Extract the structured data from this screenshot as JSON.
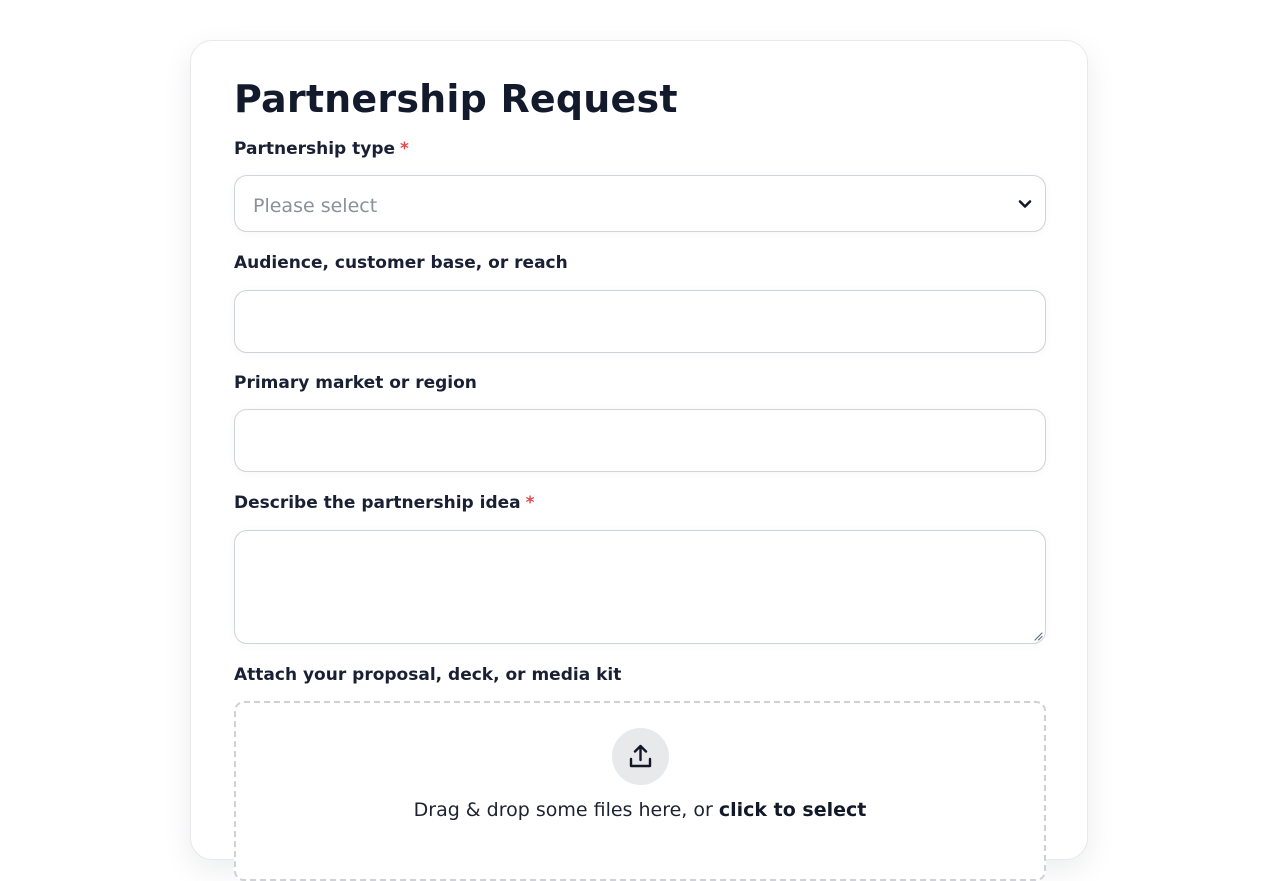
{
  "form": {
    "title": "Partnership Request",
    "required_marker": "*",
    "fields": [
      {
        "label": "Partnership type",
        "required": true,
        "type": "select",
        "value": "Please select"
      },
      {
        "label": "Audience, customer base, or reach",
        "required": false,
        "type": "text",
        "value": ""
      },
      {
        "label": "Primary market or region",
        "required": false,
        "type": "text",
        "value": ""
      },
      {
        "label": "Describe the partnership idea",
        "required": true,
        "type": "textarea",
        "value": ""
      }
    ],
    "attachment": {
      "label": "Attach your proposal, deck, or media kit",
      "drop_text": "Drag & drop some files here, or ",
      "select_text": "click to select"
    }
  },
  "icons": {
    "select": "chevron-down-icon",
    "upload": "upload-icon",
    "resize": "resize-handle-icon"
  },
  "colors": {
    "required": "#e5484d",
    "text": "#1a2033",
    "placeholder": "#8b9099",
    "border": "#cfd3da"
  }
}
